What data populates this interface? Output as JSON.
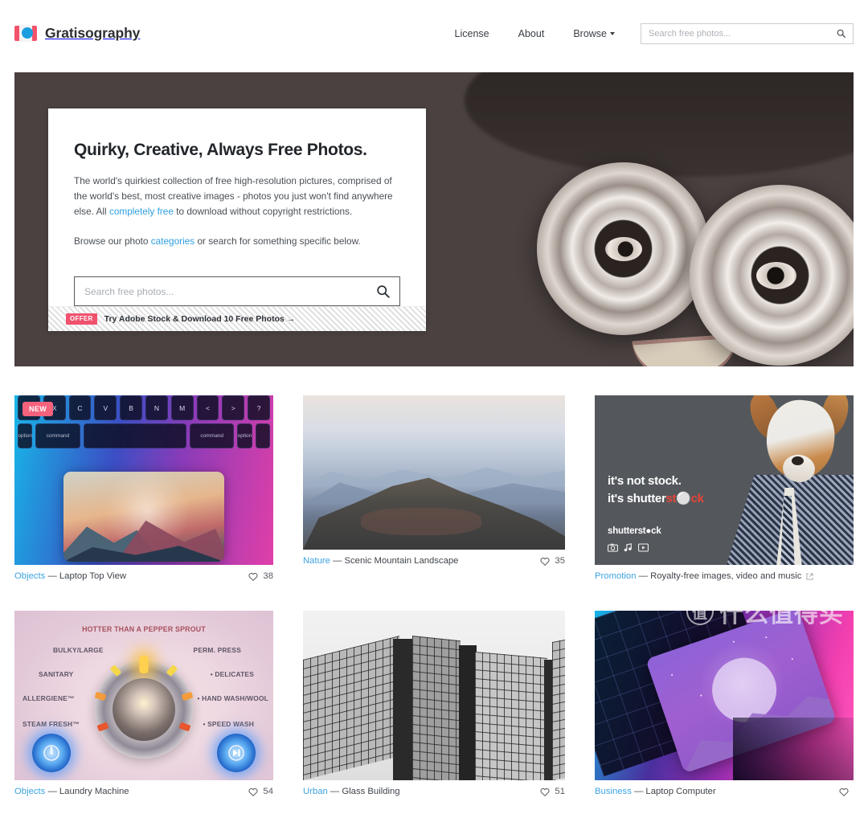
{
  "header": {
    "brand": "Gratisography",
    "logo_icon": "camera-icon",
    "logo_colors": {
      "body": "#f2526b",
      "lens": "#1b9ee0"
    },
    "nav": [
      {
        "label": "License",
        "name": "license"
      },
      {
        "label": "About",
        "name": "about"
      },
      {
        "label": "Browse",
        "name": "browse",
        "has_dropdown": true
      }
    ],
    "search": {
      "placeholder": "Search free photos...",
      "value": "",
      "icon": "search-icon"
    }
  },
  "hero": {
    "title": "Quirky, Creative, Always Free Photos.",
    "paragraph1_a": "The world's quirkiest collection of free high-resolution pictures, comprised of the world's best, most creative images - photos you just won't find anywhere else. All ",
    "paragraph1_link": "completely free",
    "paragraph1_b": " to download without copyright restrictions.",
    "paragraph2_a": "Browse our photo ",
    "paragraph2_link": "categories",
    "paragraph2_b": " or search for something specific below.",
    "search": {
      "placeholder": "Search free photos...",
      "value": "",
      "icon": "search-icon"
    },
    "offer": {
      "badge": "OFFER",
      "text": "Try Adobe Stock & Download 10 Free Photos →",
      "badge_color": "#f0516d"
    },
    "image_alt": "Man wearing tin can goggles"
  },
  "grid": {
    "cards": [
      {
        "name": "laptop-top-view",
        "category": "Objects",
        "separator": "—",
        "title": "Laptop Top View",
        "likes": "38",
        "badge": "NEW",
        "image_alt": "Neon backlit keyboard top view",
        "keyboard_keys_row1": [
          "",
          "X",
          "C",
          "V",
          "B",
          "N",
          "M",
          "<",
          ">",
          "?"
        ],
        "keyboard_keys_row2": [
          "option",
          "command",
          "",
          "command",
          "option",
          ""
        ]
      },
      {
        "name": "scenic-mountain-landscape",
        "category": "Nature",
        "separator": "—",
        "title": "Scenic Mountain Landscape",
        "likes": "35",
        "image_alt": "Blue layered mountain ridges at dusk"
      },
      {
        "name": "promotion-shutterstock",
        "category": "Promotion",
        "separator": "—",
        "title": "Royalty-free images, video and music",
        "external_link_icon": "external-link-icon",
        "image_alt": "Shutterstock advertisement with dog in suit",
        "ad": {
          "line1": "it's not stock.",
          "line2_a": "it's shutter",
          "line2_red": "st",
          "line2_c": "ck",
          "logo": "shutterst●ck",
          "icons": [
            "camera-icon",
            "music-icon",
            "video-icon"
          ],
          "accent": "#e8443a"
        }
      },
      {
        "name": "laundry-machine",
        "category": "Objects",
        "separator": "—",
        "title": "Laundry Machine",
        "likes": "54",
        "image_alt": "Washing machine control dial",
        "dial_labels": {
          "title": "HOTTER THAN A PEPPER SPROUT",
          "left": [
            "BULKY/LARGE",
            "SANITARY",
            "ALLERGIENE™",
            "STEAM FRESH™"
          ],
          "right": [
            "PERM. PRESS",
            "• DELICATES",
            "• HAND WASH/WOOL",
            "• SPEED WASH"
          ]
        }
      },
      {
        "name": "glass-building",
        "category": "Urban",
        "separator": "—",
        "title": "Glass Building",
        "likes": "51",
        "image_alt": "Black and white glass office building"
      },
      {
        "name": "laptop-computer",
        "category": "Business",
        "separator": "—",
        "title": "Laptop Computer",
        "likes": "",
        "image_alt": "Laptop keyboard with neon pink and blue lighting"
      }
    ]
  },
  "watermark": {
    "logo_char": "值",
    "text": "什么值得买"
  },
  "colors": {
    "link_blue": "#3ca3e3",
    "hero_link_blue": "#2f9fe0",
    "badge_pink": "#f4627c",
    "offer_pink": "#f0516d",
    "text_dark": "#2c2f33"
  }
}
